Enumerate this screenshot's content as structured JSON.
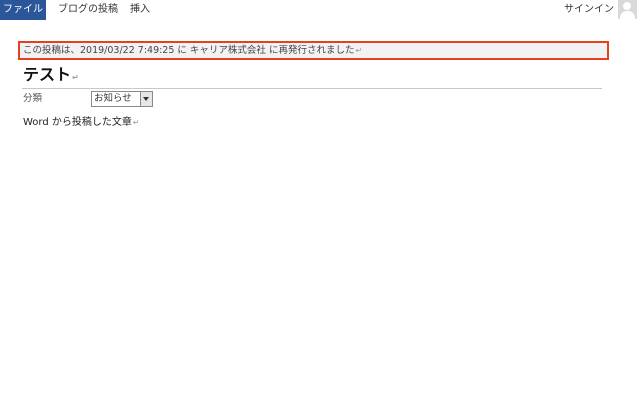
{
  "ribbon": {
    "tabs": {
      "file": "ファイル",
      "blog_post": "ブログの投稿",
      "insert": "挿入"
    },
    "signin": "サインイン",
    "user_icon": "user-avatar-icon",
    "accent_color": "#2b579a"
  },
  "document": {
    "notice_text": "この投稿は、2019/03/22 7:49:25 に キャリア株式会社 に再発行されました",
    "notice_border_color": "#e8401c",
    "title": "テスト",
    "category_label": "分類",
    "category_value": "お知らせ",
    "body_text": "Word から投稿した文章",
    "paragraph_mark": "↵"
  }
}
